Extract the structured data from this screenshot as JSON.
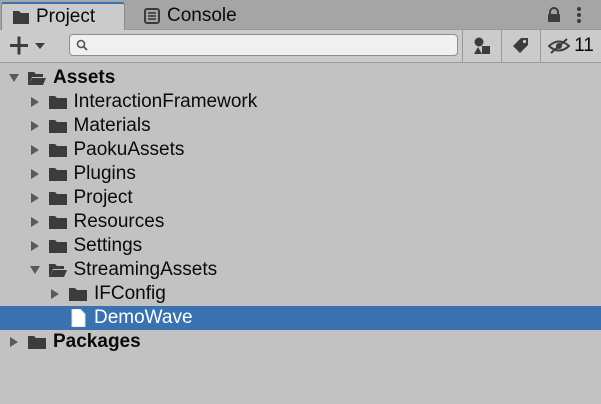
{
  "tabs": [
    {
      "label": "Project",
      "icon": "folder-icon",
      "active": true
    },
    {
      "label": "Console",
      "icon": "console-icon",
      "active": false
    }
  ],
  "toolbar": {
    "create_icon": "plus-icon",
    "search": {
      "value": "",
      "placeholder": ""
    },
    "hidden_packages_count": "11"
  },
  "tree": [
    {
      "label": "Assets",
      "depth": 0,
      "expanded": true,
      "kind": "folder",
      "bold": true
    },
    {
      "label": "InteractionFramework",
      "depth": 1,
      "expanded": false,
      "kind": "folder"
    },
    {
      "label": "Materials",
      "depth": 1,
      "expanded": false,
      "kind": "folder"
    },
    {
      "label": "PaokuAssets",
      "depth": 1,
      "expanded": false,
      "kind": "folder"
    },
    {
      "label": "Plugins",
      "depth": 1,
      "expanded": false,
      "kind": "folder"
    },
    {
      "label": "Project",
      "depth": 1,
      "expanded": false,
      "kind": "folder"
    },
    {
      "label": "Resources",
      "depth": 1,
      "expanded": false,
      "kind": "folder"
    },
    {
      "label": "Settings",
      "depth": 1,
      "expanded": false,
      "kind": "folder"
    },
    {
      "label": "StreamingAssets",
      "depth": 1,
      "expanded": true,
      "kind": "folder"
    },
    {
      "label": "IFConfig",
      "depth": 2,
      "expanded": false,
      "kind": "folder"
    },
    {
      "label": "DemoWave",
      "depth": 2,
      "kind": "file",
      "selected": true
    },
    {
      "label": "Packages",
      "depth": 0,
      "expanded": false,
      "kind": "folder",
      "bold": true
    }
  ],
  "colors": {
    "selection": "#3a72b0",
    "panel": "#c2c2c2",
    "tabbar": "#a5a5a5",
    "icon": "#3c3c3c"
  }
}
